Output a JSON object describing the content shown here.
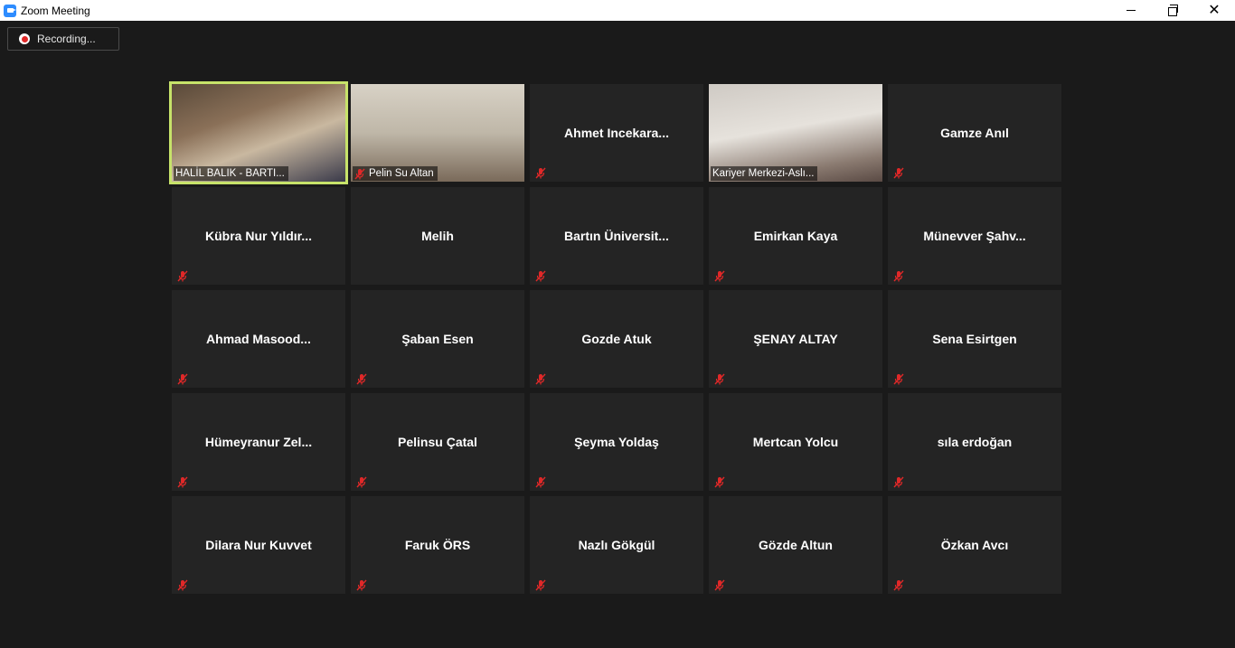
{
  "window": {
    "title": "Zoom Meeting",
    "icon": "zoom-camera-icon",
    "controls": [
      "minimize-icon",
      "restore-icon",
      "close-icon"
    ]
  },
  "recording": {
    "label": "Recording...",
    "status_color": "#e02828"
  },
  "colors": {
    "active_speaker_border": "#c7e36a",
    "tile_bg": "#242424",
    "mute_red": "#e02828"
  },
  "participants": [
    {
      "name": "HALİL BALIK - BARTI...",
      "video": true,
      "muted": false,
      "active": true
    },
    {
      "name": "Pelin Su Altan",
      "video": true,
      "muted": true
    },
    {
      "name": "Ahmet  Incekara...",
      "video": false,
      "muted": true
    },
    {
      "name": "Kariyer Merkezi-Aslı...",
      "video": true,
      "muted": false
    },
    {
      "name": "Gamze Anıl",
      "video": false,
      "muted": true
    },
    {
      "name": "Kübra  Nur  Yıldır...",
      "video": false,
      "muted": true
    },
    {
      "name": "Melih",
      "video": false,
      "muted": false
    },
    {
      "name": "Bartın  Üniversit...",
      "video": false,
      "muted": true
    },
    {
      "name": "Emirkan Kaya",
      "video": false,
      "muted": true
    },
    {
      "name": "Münevver  Şahv...",
      "video": false,
      "muted": true
    },
    {
      "name": "Ahmad  Masood...",
      "video": false,
      "muted": true
    },
    {
      "name": "Şaban Esen",
      "video": false,
      "muted": true
    },
    {
      "name": "Gozde Atuk",
      "video": false,
      "muted": true
    },
    {
      "name": "ŞENAY ALTAY",
      "video": false,
      "muted": true
    },
    {
      "name": "Sena Esirtgen",
      "video": false,
      "muted": true
    },
    {
      "name": "Hümeyranur  Zel...",
      "video": false,
      "muted": true
    },
    {
      "name": "Pelinsu Çatal",
      "video": false,
      "muted": true
    },
    {
      "name": "Şeyma Yoldaş",
      "video": false,
      "muted": true
    },
    {
      "name": "Mertcan Yolcu",
      "video": false,
      "muted": true
    },
    {
      "name": "sıla erdoğan",
      "video": false,
      "muted": true
    },
    {
      "name": "Dilara Nur Kuvvet",
      "video": false,
      "muted": true
    },
    {
      "name": "Faruk ÖRS",
      "video": false,
      "muted": true
    },
    {
      "name": "Nazlı Gökgül",
      "video": false,
      "muted": true
    },
    {
      "name": "Gözde Altun",
      "video": false,
      "muted": true
    },
    {
      "name": "Özkan Avcı",
      "video": false,
      "muted": true
    }
  ]
}
